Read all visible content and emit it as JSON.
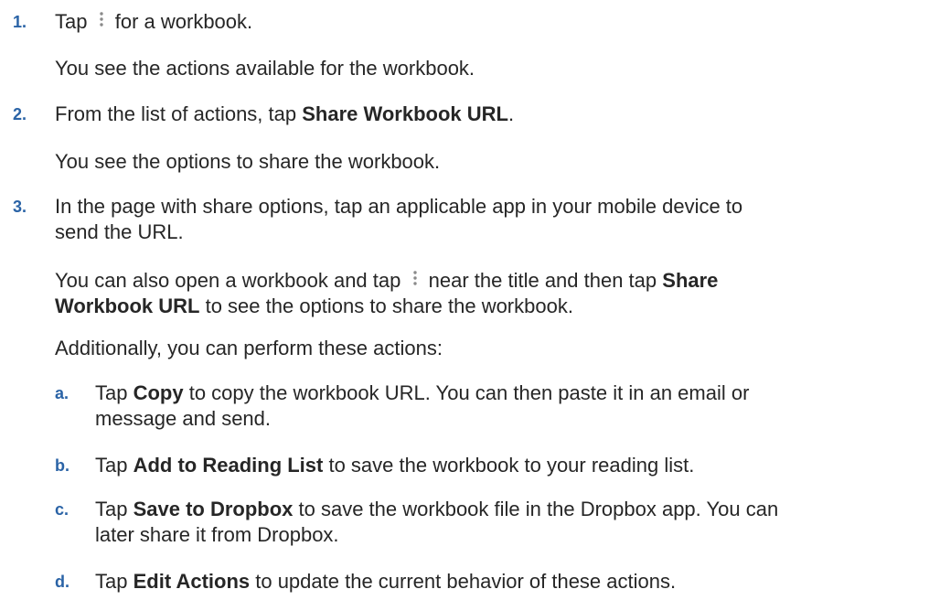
{
  "steps": [
    {
      "num": "1.",
      "lines": [
        {
          "pre": "Tap",
          "icon": "vertical-ellipsis-icon",
          "post": "for a workbook."
        }
      ],
      "note": "You see the actions available for the workbook."
    },
    {
      "num": "2.",
      "text_pre": "From the list of actions, tap ",
      "text_bold": "Share Workbook URL",
      "text_post": ".",
      "note": "You see the options to share the workbook."
    },
    {
      "num": "3.",
      "line1": "In the page with share options, tap an applicable app in your mobile device to",
      "line2": "send the URL.",
      "also_pre": "You can also open a workbook and tap",
      "also_icon": "vertical-ellipsis-icon",
      "also_mid": "near the title and then tap ",
      "also_bold1": "Share",
      "also_bold2": "Workbook URL",
      "also_post": " to see the options to share the workbook.",
      "additionally": "Additionally, you can perform these actions:"
    }
  ],
  "substeps": [
    {
      "letter": "a.",
      "pre": "Tap ",
      "bold": "Copy",
      "post": " to copy the workbook URL. You can then paste it in an email or",
      "line2": "message and send."
    },
    {
      "letter": "b.",
      "pre": "Tap ",
      "bold": "Add to Reading List",
      "post": " to save the workbook to your reading list."
    },
    {
      "letter": "c.",
      "pre": "Tap ",
      "bold": "Save to Dropbox",
      "post": " to save the workbook file in the Dropbox app. You can",
      "line2": "later share it from Dropbox."
    },
    {
      "letter": "d.",
      "pre": "Tap ",
      "bold": "Edit Actions",
      "post": " to update the current behavior of these actions."
    }
  ]
}
